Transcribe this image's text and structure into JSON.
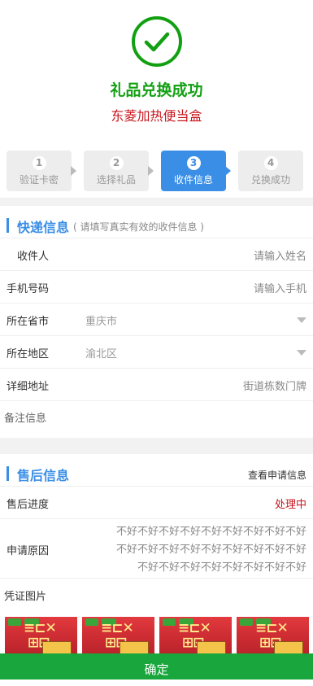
{
  "header": {
    "title": "礼品兑换成功",
    "subtitle": "东菱加热便当盒"
  },
  "colors": {
    "success": "#12a012",
    "accent_red": "#c8161d",
    "accent_blue": "#3a8ee6",
    "confirm_green": "#19a63c"
  },
  "steps": [
    {
      "num": "1",
      "label": "验证卡密",
      "active": false
    },
    {
      "num": "2",
      "label": "选择礼品",
      "active": false
    },
    {
      "num": "3",
      "label": "收件信息",
      "active": true
    },
    {
      "num": "4",
      "label": "兑换成功",
      "active": false
    }
  ],
  "delivery": {
    "title": "快递信息",
    "note": "( 请填写真实有效的收件信息 )",
    "fields": {
      "recipient_label": "收件人",
      "recipient_placeholder": "请输入姓名",
      "phone_label": "手机号码",
      "phone_placeholder": "请输入手机",
      "province_label": "所在省市",
      "province_value": "重庆市",
      "district_label": "所在地区",
      "district_value": "渝北区",
      "address_label": "详细地址",
      "address_placeholder": "街道栋数门牌",
      "remark_placeholder": "备注信息"
    }
  },
  "after_sale": {
    "title": "售后信息",
    "view_link": "查看申请信息",
    "progress_label": "售后进度",
    "progress_value": "处理中",
    "reason_label": "申请原因",
    "reason_lines": [
      "不好不好不好不好不好不好不好不好不好",
      "不好不好不好不好不好不好不好不好不好",
      "不好不好不好不好不好不好不好不好"
    ],
    "voucher_label": "凭证图片",
    "photo_icons": [
      "product-photo-thumbnail",
      "product-photo-thumbnail",
      "product-photo-thumbnail",
      "product-photo-thumbnail"
    ]
  },
  "footer": {
    "confirm_label": "确定"
  }
}
